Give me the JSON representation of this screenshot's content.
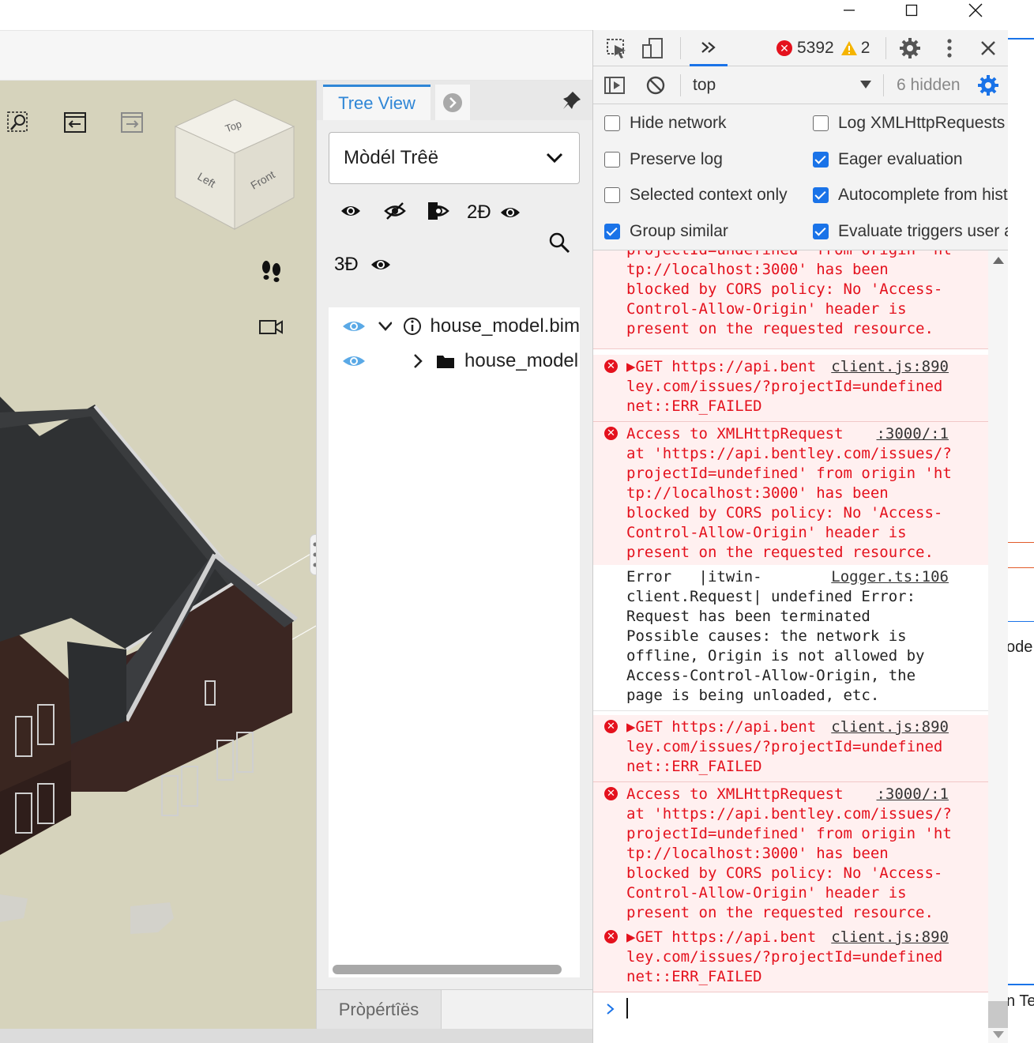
{
  "window": {
    "minimize_icon": "minimize-icon",
    "maximize_icon": "maximize-icon",
    "close_icon": "close-icon"
  },
  "viewport": {
    "tools": [
      "window-area-icon",
      "view-undo-icon",
      "view-redo-icon"
    ],
    "cube": {
      "top": "Top",
      "left": "Left",
      "front": "Front"
    },
    "walk_icon": "footprints-icon",
    "camera_icon": "camera-icon"
  },
  "tree_panel": {
    "tab_label": "Tree View",
    "model_select_value": "Mòdél Trêë",
    "label_2d": "2Đ",
    "label_3d": "3Đ",
    "rows": [
      {
        "label": "house_model.bim"
      },
      {
        "label": "house_model"
      }
    ],
    "properties_tab": "Pròpértîës"
  },
  "devtools": {
    "error_count": "5392",
    "warning_count": "2",
    "context": "top",
    "hidden_count": "6 hidden",
    "settings": {
      "hide_network": "Hide network",
      "log_xhr": "Log XMLHttpRequests",
      "preserve_log": "Preserve log",
      "eager_eval": "Eager evaluation",
      "selected_context": "Selected context only",
      "autocomplete": "Autocomplete from history",
      "group_similar": "Group similar",
      "evaluate_triggers": "Evaluate triggers user activation"
    },
    "messages": [
      {
        "lines": [
          "projectId=undefined' from origin 'ht",
          "tp://localhost:3000' has been",
          "blocked by CORS policy: No 'Access-",
          "Control-Allow-Origin' header is",
          "present on the requested resource."
        ]
      },
      {
        "lines": [
          "▶GET https://api.bent",
          "ley.com/issues/?projectId=undefined",
          "net::ERR_FAILED"
        ],
        "source": "client.js:890"
      },
      {
        "lines": [
          "Access to XMLHttpRequest",
          "at 'https://api.bentley.com/issues/?",
          "projectId=undefined' from origin 'ht",
          "tp://localhost:3000' has been",
          "blocked by CORS policy: No 'Access-",
          "Control-Allow-Origin' header is",
          "present on the requested resource."
        ],
        "source": ":3000/:1"
      },
      {
        "lines": [
          "Error   |itwin-",
          "client.Request| undefined Error:",
          "Request has been terminated",
          "Possible causes: the network is",
          "offline, Origin is not allowed by",
          "Access-Control-Allow-Origin, the",
          "page is being unloaded, etc."
        ],
        "source": "Logger.ts:106"
      },
      {
        "lines": [
          "▶GET https://api.bent",
          "ley.com/issues/?projectId=undefined",
          "net::ERR_FAILED"
        ],
        "source": "client.js:890"
      },
      {
        "lines": [
          "Access to XMLHttpRequest",
          "at 'https://api.bentley.com/issues/?",
          "projectId=undefined' from origin 'ht",
          "tp://localhost:3000' has been",
          "blocked by CORS policy: No 'Access-",
          "Control-Allow-Origin' header is",
          "present on the requested resource."
        ],
        "source": ":3000/:1"
      },
      {
        "lines": [
          "▶GET https://api.bent",
          "ley.com/issues/?projectId=undefined",
          "net::ERR_FAILED"
        ],
        "source": "client.js:890"
      }
    ]
  },
  "sliver": {
    "text1": "ode",
    "text2": "n Te"
  },
  "colors": {
    "accent": "#2f86d6",
    "error": "#e4111d",
    "devtools_blue": "#1a73e8",
    "viewport_bg": "#d6d3bc"
  }
}
